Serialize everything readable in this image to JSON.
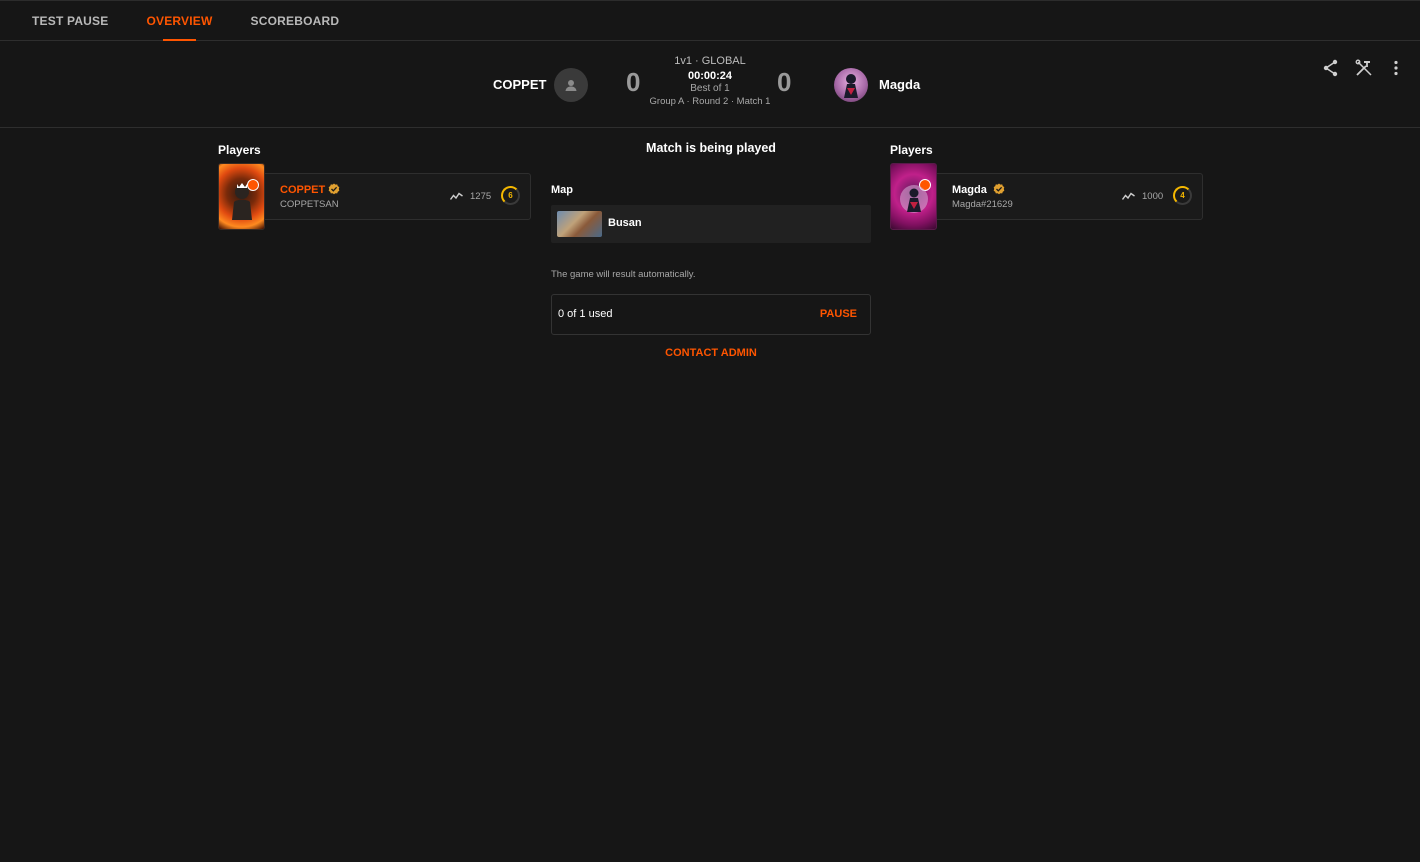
{
  "tabs": [
    {
      "label": "TEST PAUSE"
    },
    {
      "label": "OVERVIEW"
    },
    {
      "label": "SCOREBOARD"
    }
  ],
  "header": {
    "mode": "1v1 · GLOBAL",
    "timer": "00:00:24",
    "best_of": "Best of 1",
    "grouping": "Group A · Round 2 · Match 1",
    "left_team": {
      "name": "COPPET",
      "score": "0"
    },
    "right_team": {
      "name": "Magda",
      "score": "0"
    },
    "icons": [
      "share-icon",
      "tools-icon",
      "more-vertical-icon"
    ]
  },
  "left_column": {
    "title": "Players",
    "player": {
      "name": "COPPET",
      "sub": "COPPETSAN",
      "elo": "1275",
      "level": "6",
      "name_color": "#ff5500"
    }
  },
  "right_column": {
    "title": "Players",
    "player": {
      "name": "Magda",
      "sub": "Magda#21629",
      "elo": "1000",
      "level": "4",
      "name_color": "#ffffff"
    }
  },
  "center": {
    "status": "Match is being played",
    "map_label": "Map",
    "map_name": "Busan",
    "auto_note": "The game will result automatically.",
    "pause_used": "0 of 1 used",
    "pause_label": "PAUSE",
    "contact_label": "CONTACT ADMIN"
  },
  "colors": {
    "accent": "#ff5500",
    "background": "#161616",
    "level": "#f5b800"
  }
}
